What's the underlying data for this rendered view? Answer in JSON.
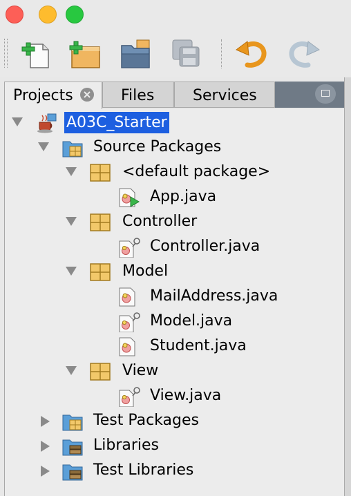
{
  "window": {
    "controls": [
      "close",
      "minimize",
      "zoom"
    ]
  },
  "toolbar": {
    "buttons": [
      {
        "name": "new-file",
        "icon": "new-file-icon"
      },
      {
        "name": "new-project",
        "icon": "new-project-icon"
      },
      {
        "name": "open-project",
        "icon": "open-project-icon"
      },
      {
        "name": "save-all",
        "icon": "save-all-icon"
      },
      {
        "name": "undo",
        "icon": "undo-icon"
      },
      {
        "name": "redo",
        "icon": "redo-icon"
      }
    ]
  },
  "tabs": [
    {
      "label": "Projects",
      "active": true
    },
    {
      "label": "Files",
      "active": false
    },
    {
      "label": "Services",
      "active": false
    }
  ],
  "tree": {
    "root": {
      "label": "A03C_Starter",
      "selected": true,
      "expanded": true
    },
    "source_packages": {
      "label": "Source Packages",
      "expanded": true
    },
    "default_package": {
      "label": "<default package>"
    },
    "app_java": {
      "label": "App.java"
    },
    "controller_pkg": {
      "label": "Controller"
    },
    "controller_java": {
      "label": "Controller.java"
    },
    "model_pkg": {
      "label": "Model"
    },
    "mailaddress_java": {
      "label": "MailAddress.java"
    },
    "model_java": {
      "label": "Model.java"
    },
    "student_java": {
      "label": "Student.java"
    },
    "view_pkg": {
      "label": "View"
    },
    "view_java": {
      "label": "View.java"
    },
    "test_packages": {
      "label": "Test Packages",
      "expanded": false
    },
    "libraries": {
      "label": "Libraries",
      "expanded": false
    },
    "test_libraries": {
      "label": "Test Libraries",
      "expanded": false
    }
  },
  "colors": {
    "selection": "#1d5fe0",
    "package": "#f2c86a",
    "folder": "#5b9fd8"
  }
}
